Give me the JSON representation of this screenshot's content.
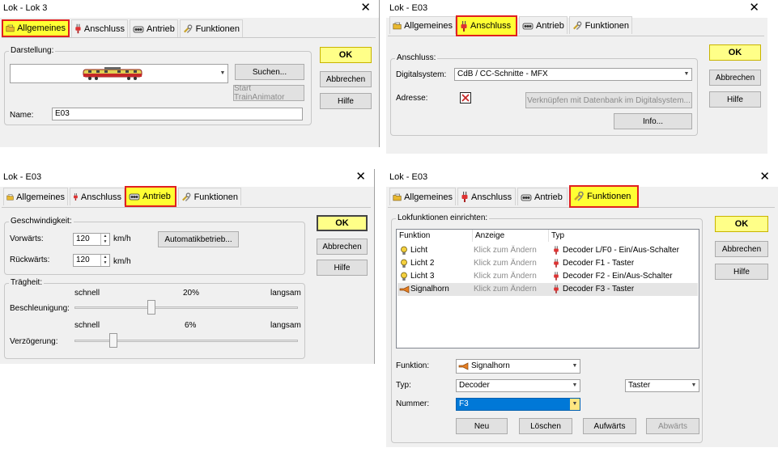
{
  "colors": {
    "highlight": "#ffff33",
    "highlight_border": "#e02020",
    "ok_button": "#ffff88",
    "selection": "#0078d7"
  },
  "icons": {
    "allgemeines": "folder-icon",
    "anschluss": "connector-icon",
    "antrieb": "engine-icon",
    "funktionen": "wrench-icon",
    "close": "close-icon",
    "checkbox": "checkbox-icon",
    "locomotive": "locomotive-preview-image"
  },
  "close_glyph": "✕",
  "dlg1": {
    "title": "Lok - Lok 3",
    "tabs": [
      "Allgemeines",
      "Anschluss",
      "Antrieb",
      "Funktionen"
    ],
    "selected_tab": "Allgemeines",
    "group_darstellung": "Darstellung:",
    "btn_suchen": "Suchen...",
    "btn_start": "Start TrainAnimator",
    "name_label": "Name:",
    "name_value": "E03",
    "ok": "OK",
    "cancel": "Abbrechen",
    "help": "Hilfe"
  },
  "dlg2": {
    "title": "Lok - E03",
    "tabs": [
      "Allgemeines",
      "Anschluss",
      "Antrieb",
      "Funktionen"
    ],
    "selected_tab": "Anschluss",
    "group_anschluss": "Anschluss:",
    "digitalsystem_label": "Digitalsystem:",
    "digitalsystem_value": "CdB / CC-Schnitte - MFX",
    "adresse_label": "Adresse:",
    "btn_verknuepfen": "Verknüpfen mit Datenbank im Digitalsystem...",
    "btn_info": "Info...",
    "ok": "OK",
    "cancel": "Abbrechen",
    "help": "Hilfe"
  },
  "dlg3": {
    "title": "Lok - E03",
    "tabs": [
      "Allgemeines",
      "Anschluss",
      "Antrieb",
      "Funktionen"
    ],
    "selected_tab": "Antrieb",
    "group_geschwindigkeit": "Geschwindigkeit:",
    "vorwaerts_label": "Vorwärts:",
    "vorwaerts_value": "120",
    "rueckwaerts_label": "Rückwärts:",
    "rueckwaerts_value": "120",
    "unit": "km/h",
    "btn_automatik": "Automatikbetrieb...",
    "group_traegheit": "Trägheit:",
    "schnell": "schnell",
    "langsam": "langsam",
    "beschleunigung_label": "Beschleunigung:",
    "beschleunigung_pct": "20%",
    "beschleunigung_level": 0.34,
    "verzoegerung_label": "Verzögerung:",
    "verzoegerung_pct": "6%",
    "verzoegerung_level": 0.16,
    "ok": "OK",
    "cancel": "Abbrechen",
    "help": "Hilfe"
  },
  "dlg4": {
    "title": "Lok - E03",
    "tabs": [
      "Allgemeines",
      "Anschluss",
      "Antrieb",
      "Funktionen"
    ],
    "selected_tab": "Funktionen",
    "group_lokfunktionen": "Lokfunktionen einrichten:",
    "columns": [
      "Funktion",
      "Anzeige",
      "Typ"
    ],
    "rows": [
      {
        "funktion": "Licht",
        "anzeige": "Klick zum Ändern",
        "typ": "Decoder L/F0 - Ein/Aus-Schalter",
        "icon": "light-bulb-icon"
      },
      {
        "funktion": "Licht 2",
        "anzeige": "Klick zum Ändern",
        "typ": "Decoder F1 - Taster",
        "icon": "light-bulb-icon"
      },
      {
        "funktion": "Licht 3",
        "anzeige": "Klick zum Ändern",
        "typ": "Decoder F2 - Ein/Aus-Schalter",
        "icon": "light-bulb-icon"
      },
      {
        "funktion": "Signalhorn",
        "anzeige": "Klick zum Ändern",
        "typ": "Decoder F3 - Taster",
        "icon": "horn-icon"
      }
    ],
    "funktion_label": "Funktion:",
    "funktion_value": "Signalhorn",
    "typ_label": "Typ:",
    "typ_value": "Decoder",
    "typ2_value": "Taster",
    "nummer_label": "Nummer:",
    "nummer_value": "F3",
    "btn_neu": "Neu",
    "btn_loeschen": "Löschen",
    "btn_aufwaerts": "Aufwärts",
    "btn_abwaerts": "Abwärts",
    "ok": "OK",
    "cancel": "Abbrechen",
    "help": "Hilfe"
  }
}
